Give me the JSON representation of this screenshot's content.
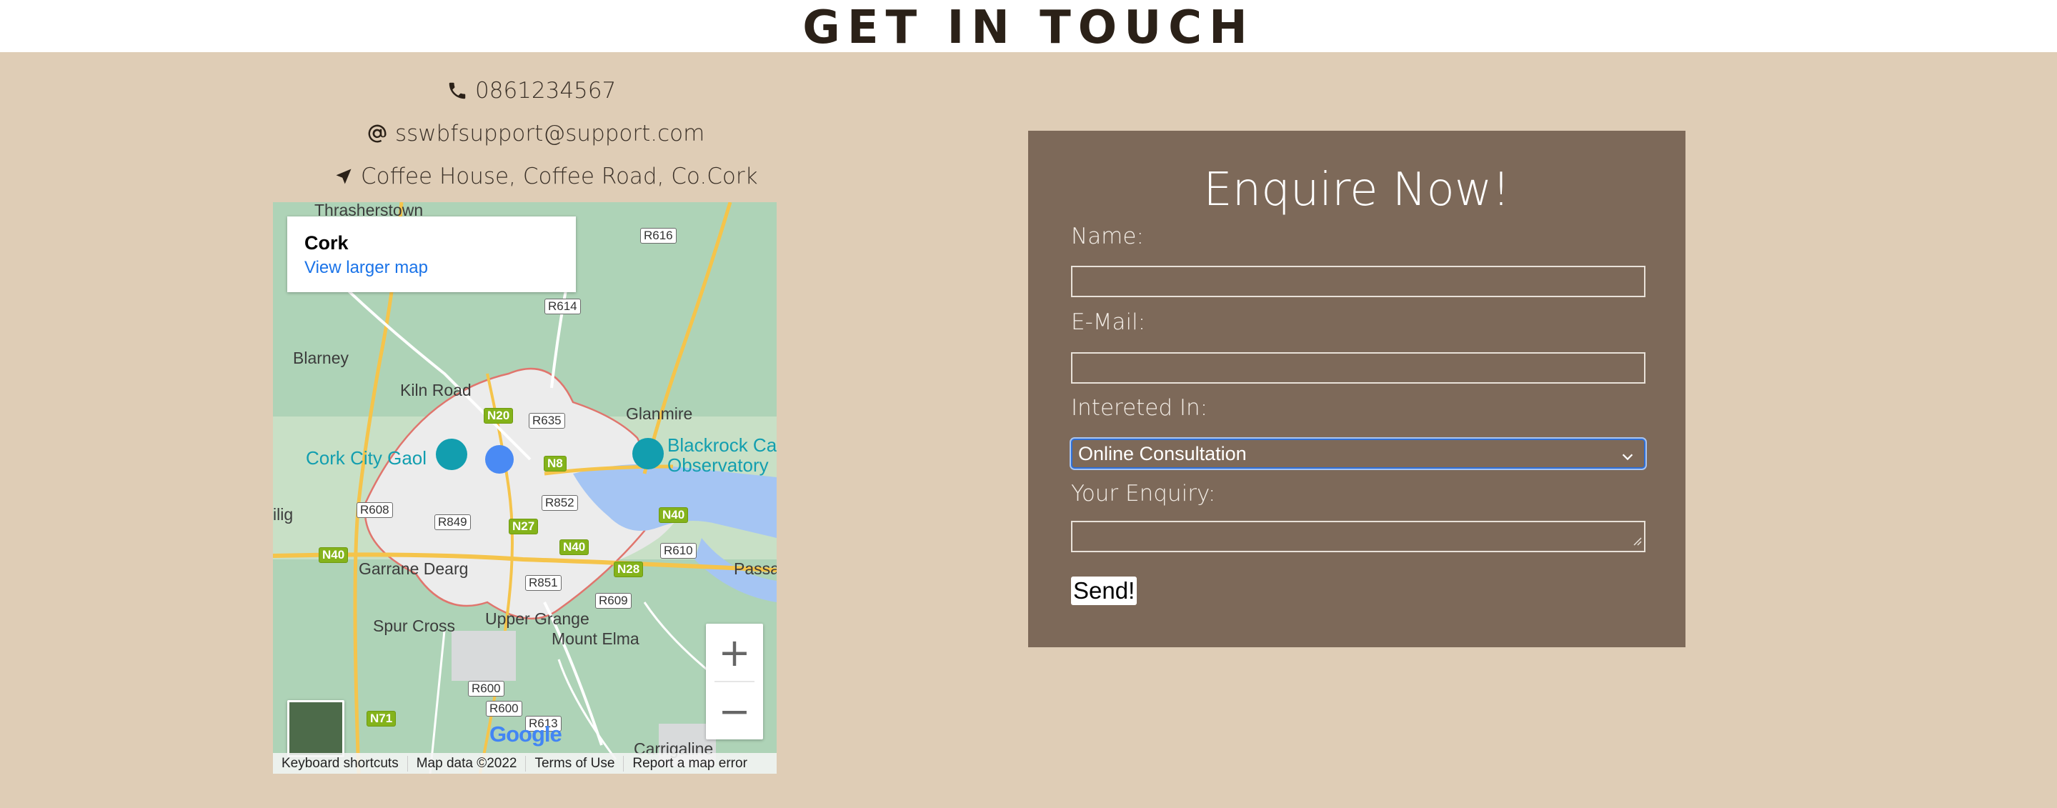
{
  "header": {
    "title": "GET IN TOUCH"
  },
  "contact": {
    "phone": "0861234567",
    "email": "sswbfsupport@support.com",
    "address": "Coffee House, Coffee Road, Co.Cork",
    "icons": [
      "phone-icon",
      "at-icon",
      "location-arrow-icon"
    ]
  },
  "map": {
    "place_title": "Cork",
    "larger_map_link": "View larger map",
    "labels": {
      "thrasherstown": "Thrasherstown",
      "blarney": "Blarney",
      "kiln_road": "Kiln Road",
      "glanmire": "Glanmire",
      "blackrock": "Blackrock Ca",
      "observatory": "Observatory",
      "cork_city_gaol": "Cork City Gaol",
      "ilig": "ilig",
      "garrane_dearg": "Garrane Dearg",
      "passa": "Passa",
      "upper_grange": "Upper Grange",
      "spur_cross": "Spur Cross",
      "mount_elma": "Mount Elma",
      "carrigaline": "Carrigaline"
    },
    "roads": {
      "r616": "R616",
      "r614": "R614",
      "r635": "R635",
      "n20": "N20",
      "n8": "N8",
      "r608": "R608",
      "r852": "R852",
      "r849": "R849",
      "n27": "N27",
      "n40a": "N40",
      "n40b": "N40",
      "n40c": "N40",
      "r610": "R610",
      "n28": "N28",
      "r851": "R851",
      "r609": "R609",
      "r600a": "R600",
      "r600b": "R600",
      "n71": "N71",
      "r613": "R613"
    },
    "zoom_in": "+",
    "zoom_out": "−",
    "google_logo": "Google",
    "attribution": {
      "shortcuts": "Keyboard shortcuts",
      "data": "Map data ©2022",
      "terms": "Terms of Use",
      "report": "Report a map error"
    }
  },
  "form": {
    "title": "Enquire Now!",
    "name_label": "Name:",
    "name_value": "",
    "email_label": "E-Mail:",
    "email_value": "",
    "interest_label": "Intereted In:",
    "interest_selected": "Online Consultation",
    "enquiry_label": "Your Enquiry:",
    "enquiry_value": "",
    "submit_label": "Send!"
  },
  "colors": {
    "page_bg": "#dfcdb6",
    "form_bg": "#7d6959",
    "title_text": "#2b2118",
    "focus_ring": "#2f6fd6"
  }
}
